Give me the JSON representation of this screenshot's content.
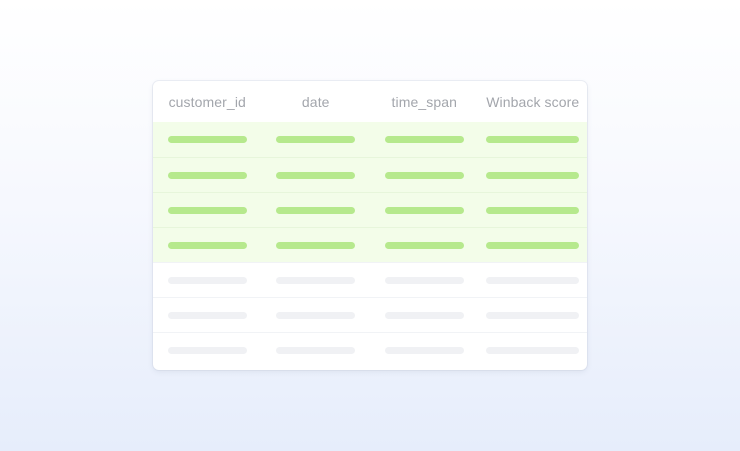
{
  "table": {
    "columns": [
      "customer_id",
      "date",
      "time_span",
      "Winback score"
    ],
    "filled_rows": 4,
    "empty_rows": 3
  },
  "colors": {
    "filled_row_background": "#f3fde9",
    "filled_bar": "#b6e98d",
    "empty_bar": "#f0f1f4",
    "header_text": "#a3a6ac"
  }
}
